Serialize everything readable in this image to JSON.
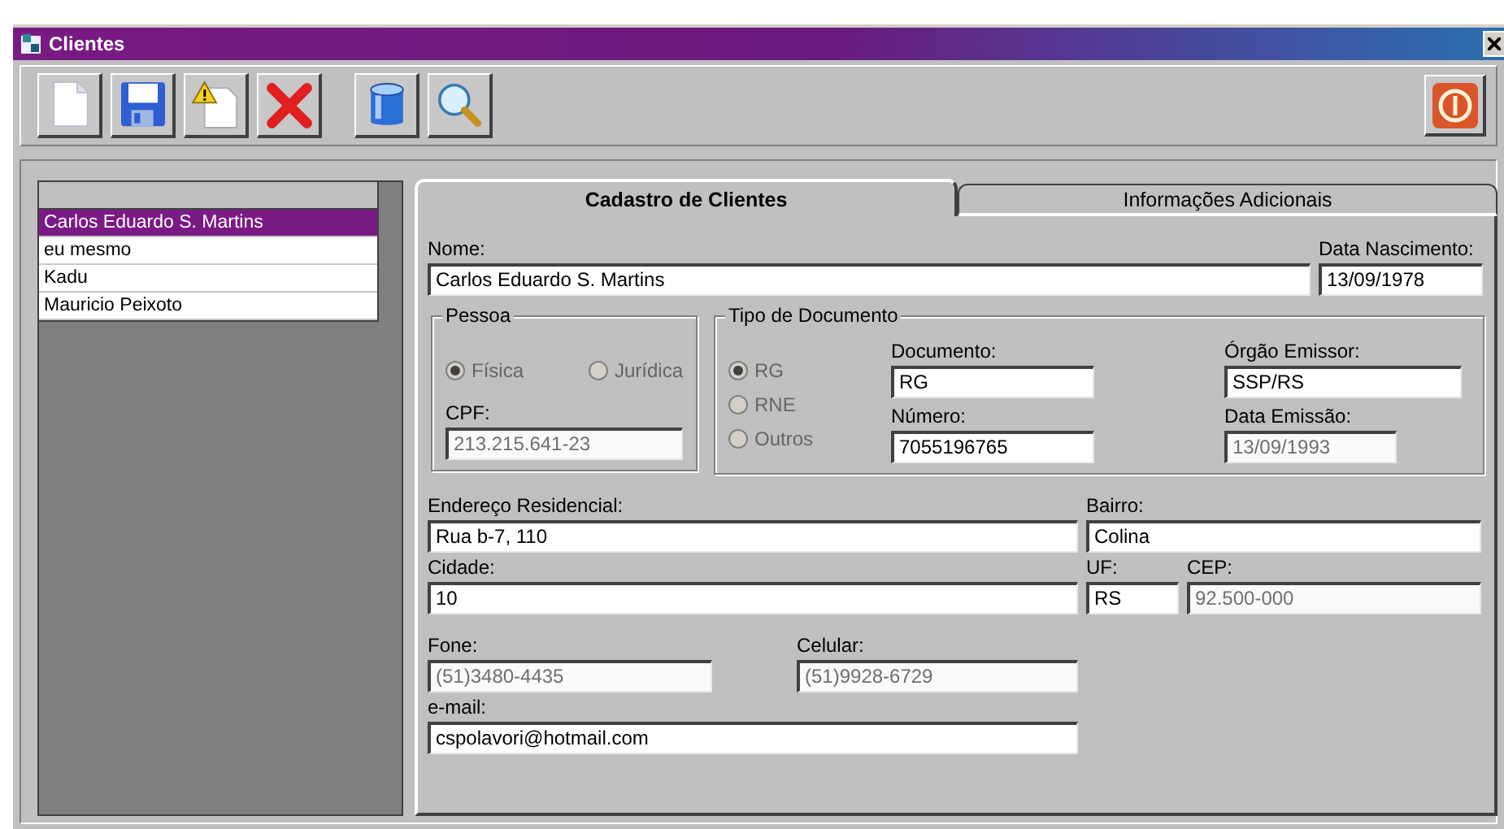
{
  "window": {
    "title": "Clientes"
  },
  "client_list": {
    "items": [
      {
        "name": "Carlos Eduardo S. Martins",
        "selected": true
      },
      {
        "name": "eu mesmo",
        "selected": false
      },
      {
        "name": "Kadu",
        "selected": false
      },
      {
        "name": "Mauricio Peixoto",
        "selected": false
      }
    ]
  },
  "tabs": [
    {
      "label": "Cadastro de Clientes",
      "selected": true
    },
    {
      "label": "Informações Adicionais",
      "selected": false
    }
  ],
  "form": {
    "nome": {
      "label": "Nome:",
      "value": "Carlos Eduardo S. Martins",
      "disabled": false
    },
    "data_nascimento": {
      "label": "Data Nascimento:",
      "value": "13/09/1978",
      "disabled": false
    },
    "pessoa": {
      "title": "Pessoa",
      "disabled": true,
      "options": [
        {
          "label": "Física",
          "selected": true
        },
        {
          "label": "Jurídica",
          "selected": false
        }
      ],
      "cpf": {
        "label": "CPF:",
        "value": "213.215.641-23",
        "disabled": true
      }
    },
    "tipo_documento": {
      "title": "Tipo de Documento",
      "disabled": true,
      "options": [
        {
          "label": "RG",
          "selected": true
        },
        {
          "label": "RNE",
          "selected": false
        },
        {
          "label": "Outros",
          "selected": false
        }
      ],
      "documento": {
        "label": "Documento:",
        "value": "RG",
        "disabled": false
      },
      "orgao_emissor": {
        "label": "Órgão Emissor:",
        "value": "SSP/RS",
        "disabled": false
      },
      "numero": {
        "label": "Número:",
        "value": "7055196765",
        "disabled": false
      },
      "data_emissao": {
        "label": "Data Emissão:",
        "value": "13/09/1993",
        "disabled": true
      }
    },
    "endereco": {
      "label": "Endereço Residencial:",
      "value": "Rua b-7, 110",
      "disabled": false
    },
    "bairro": {
      "label": "Bairro:",
      "value": "Colina",
      "disabled": false
    },
    "cidade": {
      "label": "Cidade:",
      "value": "10",
      "disabled": false
    },
    "uf": {
      "label": "UF:",
      "value": "RS",
      "disabled": false
    },
    "cep": {
      "label": "CEP:",
      "value": "92.500-000",
      "disabled": true
    },
    "fone": {
      "label": "Fone:",
      "value": "(51)3480-4435",
      "disabled": true
    },
    "celular": {
      "label": "Celular:",
      "value": "(51)9928-6729",
      "disabled": true
    },
    "email": {
      "label": "e-mail:",
      "value": "cspolavori@hotmail.com",
      "disabled": false
    }
  }
}
